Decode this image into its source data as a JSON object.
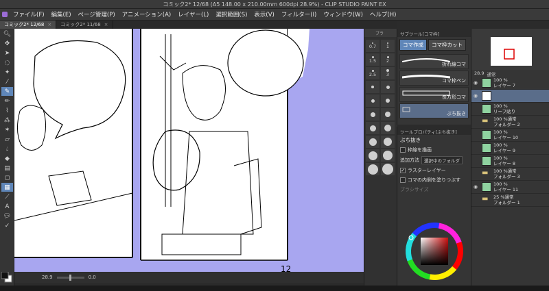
{
  "window": {
    "title": "コミック2* 12/68 (A5 148.00 x 210.00mm 600dpi 28.9%) - CLIP STUDIO PAINT EX"
  },
  "menu": [
    "ファイル(F)",
    "編集(E)",
    "ページ管理(P)",
    "アニメーション(A)",
    "レイヤー(L)",
    "選択範囲(S)",
    "表示(V)",
    "フィルター(I)",
    "ウィンドウ(W)",
    "ヘルプ(H)"
  ],
  "tabs": [
    {
      "label": "コミック2*",
      "page": "12/68",
      "active": true
    },
    {
      "label": "コミック2*",
      "page": "11/68",
      "active": false
    }
  ],
  "canvas": {
    "page_number": "12",
    "background_color": "#a8a6f0"
  },
  "statusbar": {
    "zoom": "28.9",
    "angle": "0.0"
  },
  "brush_sizes": [
    "0.7",
    "1",
    "1.5",
    "2",
    "2.5",
    "3"
  ],
  "brush_strip_header": "ブラ",
  "subtool": {
    "panel_title": "サブツール[コマ枠]",
    "tabs": [
      {
        "label": "コマ作成",
        "active": true
      },
      {
        "label": "コマ枠カット",
        "active": false
      }
    ],
    "items": [
      {
        "label": "折れ線コマ",
        "selected": false
      },
      {
        "label": "コマ枠ペン",
        "selected": false
      },
      {
        "label": "長方形コマ",
        "selected": false
      },
      {
        "label": "ぶち抜き",
        "selected": true
      }
    ]
  },
  "tool_property": {
    "panel_title": "ツールプロパティ[ぶち抜き]",
    "name": "ぶち抜き",
    "options": {
      "draw_border": "枠線を描画",
      "add_method_label": "追加方法",
      "add_method_value": "選択中のフォルダ",
      "raster_layer": "ラスターレイヤー",
      "fill_inside": "コマの内側を塗りつぶす",
      "brush_size": "ブラシサイズ"
    }
  },
  "navigator": {
    "zoom": "28.9"
  },
  "layers": {
    "blend_mode": "通常",
    "items": [
      {
        "opacity": "100 %",
        "name": "レイヤー 7",
        "type": "layer",
        "selected": false
      },
      {
        "opacity": "",
        "name": "",
        "type": "layer",
        "selected": true
      },
      {
        "opacity": "100 %",
        "name": "リーフ貼り",
        "type": "text",
        "selected": false
      },
      {
        "opacity": "100 %通常",
        "name": "フォルダー 2",
        "type": "folder",
        "selected": false
      },
      {
        "opacity": "100 %",
        "name": "レイヤー 10",
        "type": "layer",
        "selected": false
      },
      {
        "opacity": "100 %",
        "name": "レイヤー 9",
        "type": "layer",
        "selected": false
      },
      {
        "opacity": "100 %",
        "name": "レイヤー 8",
        "type": "layer",
        "selected": false
      },
      {
        "opacity": "100 %通常",
        "name": "フォルダー 3",
        "type": "folder",
        "selected": false
      },
      {
        "opacity": "100 %",
        "name": "レイヤー 11",
        "type": "layer",
        "selected": false
      },
      {
        "opacity": "25 %通常",
        "name": "フォルダー 1",
        "type": "folder",
        "selected": false
      }
    ]
  }
}
